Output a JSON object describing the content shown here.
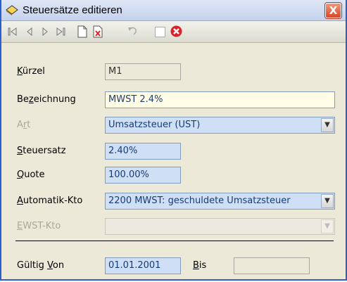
{
  "window": {
    "title": "Steuersätze editieren",
    "close_label": "X"
  },
  "form": {
    "kuerzel": {
      "label_u": "K",
      "label_rest": "ürzel",
      "value": "M1"
    },
    "bezeichnung": {
      "label_a": "Be",
      "label_u": "z",
      "label_b": "eichnung",
      "value": "MWST 2.4%"
    },
    "art": {
      "label_a": "A",
      "label_u": "r",
      "label_b": "t",
      "value": "Umsatzsteuer (UST)"
    },
    "steuersatz": {
      "label_u": "S",
      "label_rest": "teuersatz",
      "value": "2.40%"
    },
    "quote": {
      "label_u": "Q",
      "label_rest": "uote",
      "value": "100.00%"
    },
    "automatik": {
      "label_u": "A",
      "label_rest": "utomatik-Kto",
      "value": "2200 MWST: geschuldete Umsatzsteuer"
    },
    "ewst": {
      "label_u": "E",
      "label_rest": "WST-Kto",
      "value": ""
    },
    "gueltig_von": {
      "label_a": "Gültig ",
      "label_u": "V",
      "label_b": "on",
      "value": "01.01.2001"
    },
    "bis": {
      "label_u": "B",
      "label_rest": "is",
      "value": ""
    }
  }
}
